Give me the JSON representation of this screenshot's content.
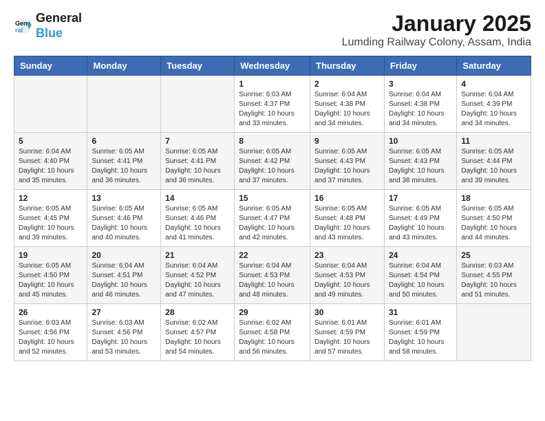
{
  "header": {
    "logo_line1": "General",
    "logo_line2": "Blue",
    "title": "January 2025",
    "subtitle": "Lumding Railway Colony, Assam, India"
  },
  "days_of_week": [
    "Sunday",
    "Monday",
    "Tuesday",
    "Wednesday",
    "Thursday",
    "Friday",
    "Saturday"
  ],
  "weeks": [
    [
      {
        "day": "",
        "info": ""
      },
      {
        "day": "",
        "info": ""
      },
      {
        "day": "",
        "info": ""
      },
      {
        "day": "1",
        "info": "Sunrise: 6:03 AM\nSunset: 4:37 PM\nDaylight: 10 hours\nand 33 minutes."
      },
      {
        "day": "2",
        "info": "Sunrise: 6:04 AM\nSunset: 4:38 PM\nDaylight: 10 hours\nand 34 minutes."
      },
      {
        "day": "3",
        "info": "Sunrise: 6:04 AM\nSunset: 4:38 PM\nDaylight: 10 hours\nand 34 minutes."
      },
      {
        "day": "4",
        "info": "Sunrise: 6:04 AM\nSunset: 4:39 PM\nDaylight: 10 hours\nand 34 minutes."
      }
    ],
    [
      {
        "day": "5",
        "info": "Sunrise: 6:04 AM\nSunset: 4:40 PM\nDaylight: 10 hours\nand 35 minutes."
      },
      {
        "day": "6",
        "info": "Sunrise: 6:05 AM\nSunset: 4:41 PM\nDaylight: 10 hours\nand 36 minutes."
      },
      {
        "day": "7",
        "info": "Sunrise: 6:05 AM\nSunset: 4:41 PM\nDaylight: 10 hours\nand 36 minutes."
      },
      {
        "day": "8",
        "info": "Sunrise: 6:05 AM\nSunset: 4:42 PM\nDaylight: 10 hours\nand 37 minutes."
      },
      {
        "day": "9",
        "info": "Sunrise: 6:05 AM\nSunset: 4:43 PM\nDaylight: 10 hours\nand 37 minutes."
      },
      {
        "day": "10",
        "info": "Sunrise: 6:05 AM\nSunset: 4:43 PM\nDaylight: 10 hours\nand 38 minutes."
      },
      {
        "day": "11",
        "info": "Sunrise: 6:05 AM\nSunset: 4:44 PM\nDaylight: 10 hours\nand 39 minutes."
      }
    ],
    [
      {
        "day": "12",
        "info": "Sunrise: 6:05 AM\nSunset: 4:45 PM\nDaylight: 10 hours\nand 39 minutes."
      },
      {
        "day": "13",
        "info": "Sunrise: 6:05 AM\nSunset: 4:46 PM\nDaylight: 10 hours\nand 40 minutes."
      },
      {
        "day": "14",
        "info": "Sunrise: 6:05 AM\nSunset: 4:46 PM\nDaylight: 10 hours\nand 41 minutes."
      },
      {
        "day": "15",
        "info": "Sunrise: 6:05 AM\nSunset: 4:47 PM\nDaylight: 10 hours\nand 42 minutes."
      },
      {
        "day": "16",
        "info": "Sunrise: 6:05 AM\nSunset: 4:48 PM\nDaylight: 10 hours\nand 43 minutes."
      },
      {
        "day": "17",
        "info": "Sunrise: 6:05 AM\nSunset: 4:49 PM\nDaylight: 10 hours\nand 43 minutes."
      },
      {
        "day": "18",
        "info": "Sunrise: 6:05 AM\nSunset: 4:50 PM\nDaylight: 10 hours\nand 44 minutes."
      }
    ],
    [
      {
        "day": "19",
        "info": "Sunrise: 6:05 AM\nSunset: 4:50 PM\nDaylight: 10 hours\nand 45 minutes."
      },
      {
        "day": "20",
        "info": "Sunrise: 6:04 AM\nSunset: 4:51 PM\nDaylight: 10 hours\nand 46 minutes."
      },
      {
        "day": "21",
        "info": "Sunrise: 6:04 AM\nSunset: 4:52 PM\nDaylight: 10 hours\nand 47 minutes."
      },
      {
        "day": "22",
        "info": "Sunrise: 6:04 AM\nSunset: 4:53 PM\nDaylight: 10 hours\nand 48 minutes."
      },
      {
        "day": "23",
        "info": "Sunrise: 6:04 AM\nSunset: 4:53 PM\nDaylight: 10 hours\nand 49 minutes."
      },
      {
        "day": "24",
        "info": "Sunrise: 6:04 AM\nSunset: 4:54 PM\nDaylight: 10 hours\nand 50 minutes."
      },
      {
        "day": "25",
        "info": "Sunrise: 6:03 AM\nSunset: 4:55 PM\nDaylight: 10 hours\nand 51 minutes."
      }
    ],
    [
      {
        "day": "26",
        "info": "Sunrise: 6:03 AM\nSunset: 4:56 PM\nDaylight: 10 hours\nand 52 minutes."
      },
      {
        "day": "27",
        "info": "Sunrise: 6:03 AM\nSunset: 4:56 PM\nDaylight: 10 hours\nand 53 minutes."
      },
      {
        "day": "28",
        "info": "Sunrise: 6:02 AM\nSunset: 4:57 PM\nDaylight: 10 hours\nand 54 minutes."
      },
      {
        "day": "29",
        "info": "Sunrise: 6:02 AM\nSunset: 4:58 PM\nDaylight: 10 hours\nand 56 minutes."
      },
      {
        "day": "30",
        "info": "Sunrise: 6:01 AM\nSunset: 4:59 PM\nDaylight: 10 hours\nand 57 minutes."
      },
      {
        "day": "31",
        "info": "Sunrise: 6:01 AM\nSunset: 4:59 PM\nDaylight: 10 hours\nand 58 minutes."
      },
      {
        "day": "",
        "info": ""
      }
    ]
  ]
}
